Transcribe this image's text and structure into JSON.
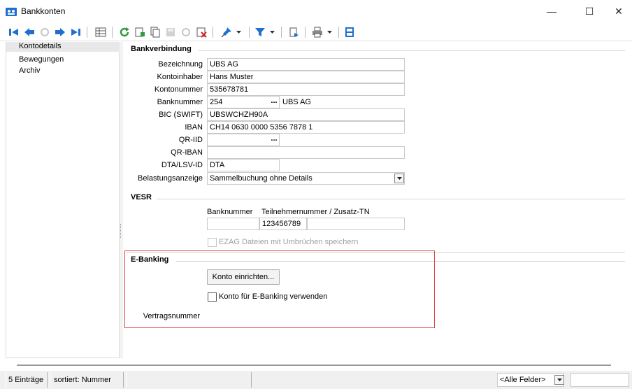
{
  "window": {
    "title": "Bankkonten",
    "minimize": "—",
    "maximize": "☐",
    "close": "✕"
  },
  "nav": {
    "items": [
      {
        "label": "Kontodetails",
        "selected": true
      },
      {
        "label": "Bewegungen",
        "selected": false
      },
      {
        "label": "Archiv",
        "selected": false
      }
    ]
  },
  "bankverbindung": {
    "title": "Bankverbindung",
    "fields": {
      "bezeichnung": {
        "label": "Bezeichnung",
        "value": "UBS AG"
      },
      "kontoinhaber": {
        "label": "Kontoinhaber",
        "value": "Hans Muster"
      },
      "kontonummer": {
        "label": "Kontonummer",
        "value": "535678781"
      },
      "banknummer": {
        "label": "Banknummer",
        "value": "254",
        "bank_name": "UBS AG"
      },
      "bic": {
        "label": "BIC (SWIFT)",
        "value": "UBSWCHZH90A"
      },
      "iban": {
        "label": "IBAN",
        "value": "CH14 0630 0000 5356 7878 1"
      },
      "qr_iid": {
        "label": "QR-IID",
        "value": ""
      },
      "qr_iban": {
        "label": "QR-IBAN",
        "value": ""
      },
      "dta": {
        "label": "DTA/LSV-ID",
        "value": "DTA"
      },
      "belastungsanzeige": {
        "label": "Belastungsanzeige",
        "value": "Sammelbuchung ohne Details"
      }
    },
    "dots": "..."
  },
  "vesr": {
    "title": "VESR",
    "col_banknummer": "Banknummer",
    "col_teilnehmer": "Teilnehmernummer / Zusatz-TN",
    "banknummer": "",
    "teilnehmer": "123456789",
    "zusatz": "",
    "ezag_label": "EZAG Dateien mit Umbrüchen speichern"
  },
  "ebanking": {
    "title": "E-Banking",
    "setup_button": "Konto einrichten...",
    "use_label": "Konto für E-Banking verwenden",
    "vertragsnummer_label": "Vertragsnummer"
  },
  "statusbar": {
    "count": "5 Einträge",
    "sorted": "sortiert: Nummer",
    "filter": "<Alle Felder>",
    "search": ""
  },
  "colors": {
    "accent_blue": "#1f6fd1",
    "highlight_red": "#e0464a",
    "green": "#2e9b3e"
  }
}
